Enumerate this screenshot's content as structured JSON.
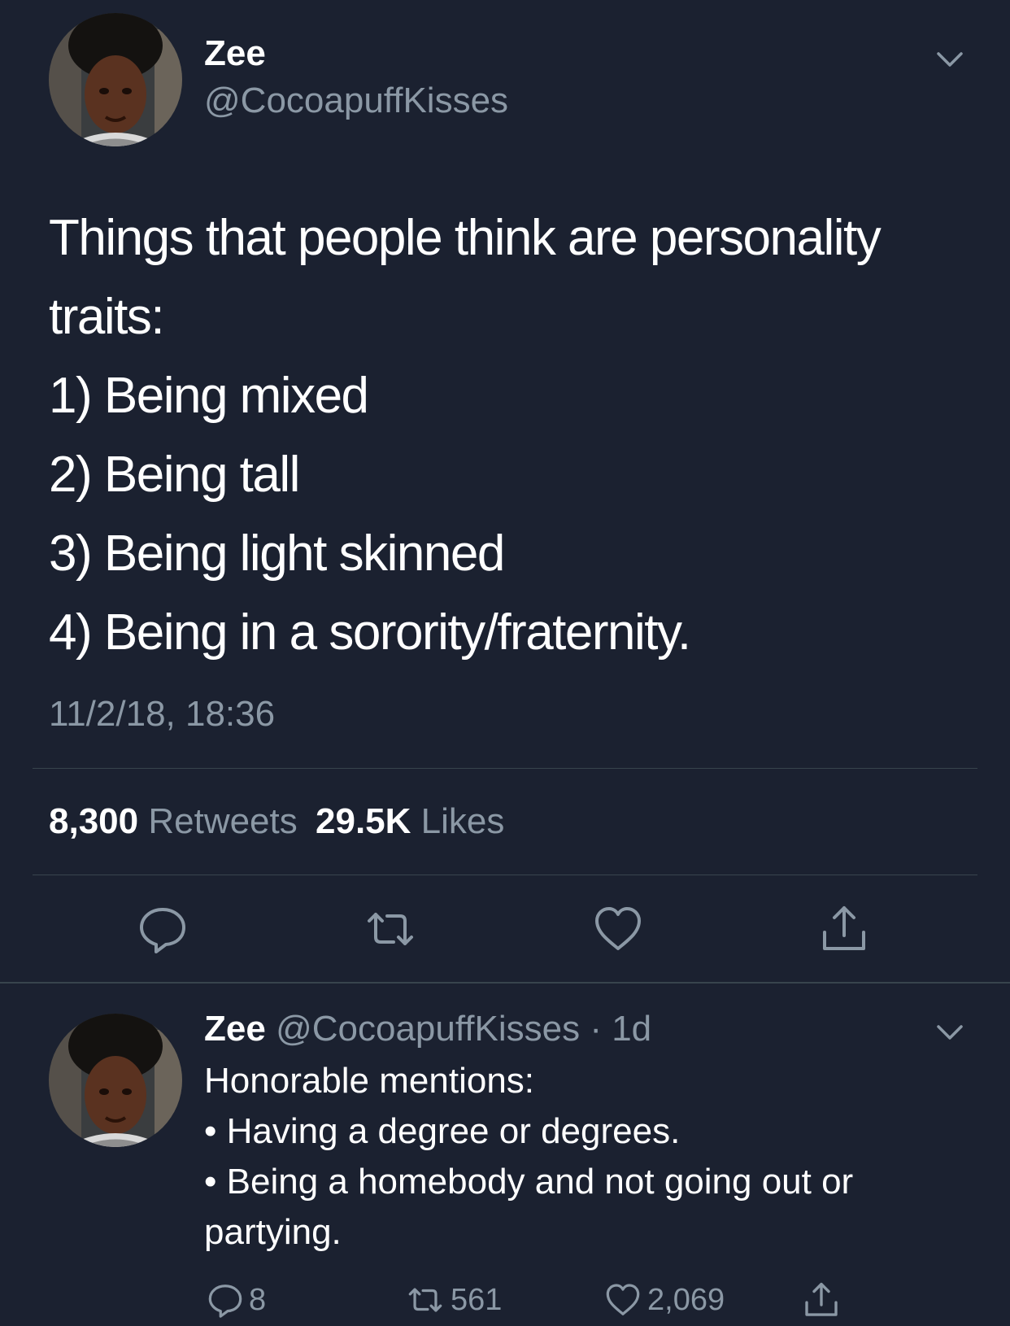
{
  "tweet": {
    "author": {
      "display_name": "Zee",
      "handle": "@CocoapuffKisses",
      "avatar_icon": "profile-photo"
    },
    "text_lines": [
      "Things that people think are personality",
      "traits:",
      "1) Being mixed",
      "2) Being tall",
      "3) Being light skinned",
      "4) Being in a sorority/fraternity."
    ],
    "timestamp": "11/2/18, 18:36",
    "stats": {
      "retweets_count": "8,300",
      "retweets_label": "Retweets",
      "likes_count": "29.5K",
      "likes_label": "Likes"
    },
    "actions": [
      "reply-icon",
      "retweet-icon",
      "like-icon",
      "share-icon"
    ]
  },
  "reply": {
    "display_name": "Zee",
    "handle_time": "@CocoapuffKisses · 1d",
    "text_lines": [
      "Honorable mentions:",
      "• Having a degree or degrees.",
      "• Being a homebody and not going out or",
      "partying."
    ],
    "counts": {
      "replies": "8",
      "retweets": "561",
      "likes": "2,069"
    }
  },
  "colors": {
    "background": "#1b2130",
    "text_primary": "#ffffff",
    "text_secondary": "#8b98a5",
    "divider": "#38444d"
  }
}
